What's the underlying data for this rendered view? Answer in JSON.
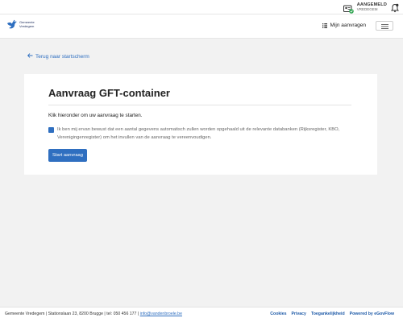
{
  "topbar": {
    "login_label": "AANGEMELD",
    "login_user": "VREDEGEM"
  },
  "header": {
    "logo_line1": "Gemeente",
    "logo_line2": "Vredegem",
    "my_requests_label": "Mijn aanvragen"
  },
  "nav": {
    "back_label": "Terug naar startscherm"
  },
  "main": {
    "title": "Aanvraag GFT-container",
    "intro": "Klik hieronder om uw aanvraag te starten.",
    "consent": "Ik ben mij ervan bewust dat een aantal gegevens automatisch zullen worden opgehaald uit de relevante databanken (Rijksregister, KBO, Verenigingenregister) om het invullen van de aanvraag te vereenvoudigen.",
    "consent_checked": true,
    "start_button": "Start aanvraag"
  },
  "footer": {
    "info": "Gemeente Vredegem | Stationslaan 23, 8200 Brugge | tel: 050 456 177 | ",
    "email": "info@vandenbroele.be",
    "links": {
      "cookies": "Cookies",
      "privacy": "Privacy",
      "accessibility": "Toegankelijkheid",
      "powered": "Powered by eGovFlow"
    }
  },
  "colors": {
    "accent": "#2f6fc0",
    "status_ok": "#2ea44f"
  }
}
